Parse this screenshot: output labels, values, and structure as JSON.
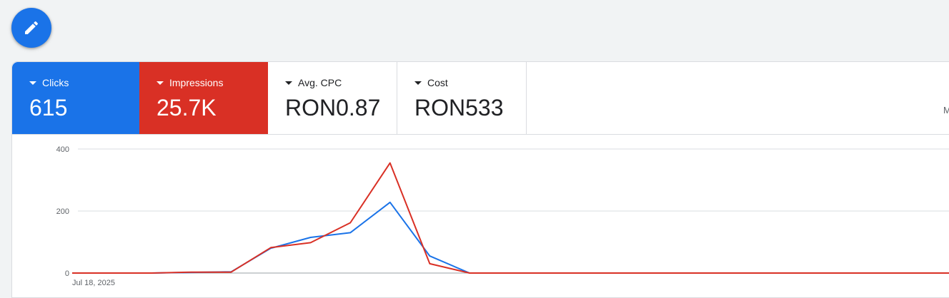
{
  "fab": {
    "icon": "pencil-icon"
  },
  "scorecards": [
    {
      "label": "Clicks",
      "value": "615",
      "color": "#1a73e8",
      "selected": true
    },
    {
      "label": "Impressions",
      "value": "25.7K",
      "color": "#d93025",
      "selected": true
    },
    {
      "label": "Avg. CPC",
      "value": "RON0.87",
      "selected": false
    },
    {
      "label": "Cost",
      "value": "RON533",
      "selected": false
    }
  ],
  "edge_text": "M",
  "chart_data": {
    "type": "line",
    "title": "",
    "xlabel": "",
    "ylabel": "",
    "x_first_label": "Jul 18, 2025",
    "y_ticks": [
      0,
      200,
      400
    ],
    "ylim": [
      0,
      400
    ],
    "grid": true,
    "series": [
      {
        "color": "#1a73e8",
        "values": [
          0,
          0,
          0,
          2,
          4,
          80,
          115,
          130,
          228,
          55,
          0,
          0,
          0,
          0,
          0,
          0,
          0,
          0,
          0,
          0,
          0,
          0,
          0
        ]
      },
      {
        "color": "#d93025",
        "values": [
          0,
          0,
          0,
          3,
          3,
          82,
          98,
          162,
          355,
          30,
          0,
          0,
          0,
          0,
          0,
          0,
          0,
          0,
          0,
          0,
          0,
          0,
          0
        ]
      }
    ]
  }
}
